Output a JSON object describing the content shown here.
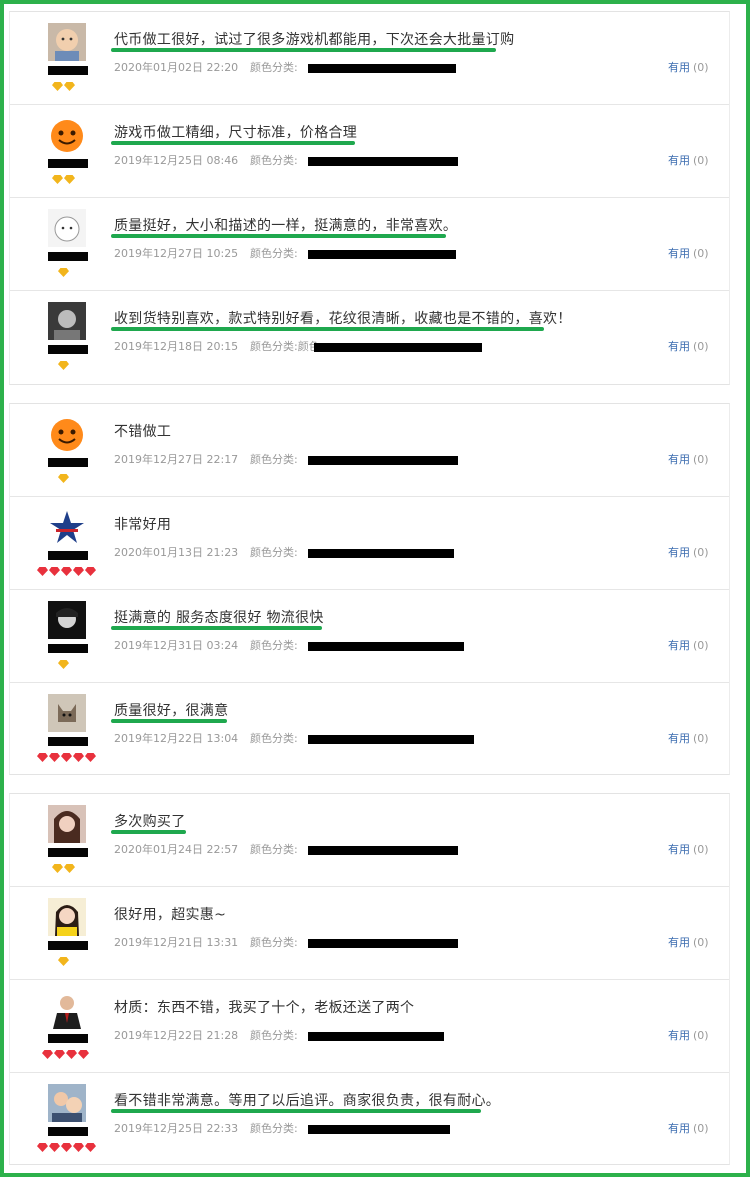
{
  "colors": {
    "frame": "#2db14b",
    "underline": "#1fa84e",
    "useful_link": "#3d6db0",
    "meta_text": "#999999"
  },
  "labels": {
    "sku": "颜色分类:",
    "useful": "有用",
    "count": "(0)"
  },
  "reviews": [
    {
      "text": "代币做工很好，试过了很多游戏机都能用，下次还会大批量订购",
      "date": "2020年01月02日 22:20",
      "sku_label": "颜色分类:",
      "avatar": "baby-photo",
      "badge": "gold",
      "badge_count": 2,
      "highlighted": true
    },
    {
      "text": "游戏币做工精细，尺寸标准，价格合理",
      "date": "2019年12月25日 08:46",
      "sku_label": "颜色分类:",
      "avatar": "orange-mascot",
      "badge": "gold",
      "badge_count": 2,
      "highlighted": true
    },
    {
      "text": "质量挺好，大小和描述的一样，挺满意的，非常喜欢。",
      "date": "2019年12月27日 10:25",
      "sku_label": "颜色分类:",
      "avatar": "white-cartoon",
      "badge": "gold",
      "badge_count": 1,
      "highlighted": true
    },
    {
      "text": "收到货特别喜欢，款式特别好看，花纹很清晰，收藏也是不错的，喜欢！",
      "date": "2019年12月18日 20:15",
      "sku_label": "颜色分类:颜色",
      "avatar": "dark-photo",
      "badge": "gold",
      "badge_count": 1,
      "highlighted": true
    },
    {
      "text": "不错做工",
      "date": "2019年12月27日 22:17",
      "sku_label": "颜色分类:",
      "avatar": "orange-mascot",
      "badge": "gold",
      "badge_count": 1,
      "highlighted": false
    },
    {
      "text": "非常好用",
      "date": "2020年01月13日 21:23",
      "sku_label": "颜色分类:",
      "avatar": "star-flag",
      "badge": "red",
      "badge_count": 5,
      "highlighted": false
    },
    {
      "text": "挺满意的 服务态度很好 物流很快",
      "date": "2019年12月31日 03:24",
      "sku_label": "颜色分类:",
      "avatar": "bw-portrait",
      "badge": "gold",
      "badge_count": 1,
      "highlighted": true
    },
    {
      "text": "质量很好，很满意",
      "date": "2019年12月22日 13:04",
      "sku_label": "颜色分类:",
      "avatar": "cat-sketch",
      "badge": "red",
      "badge_count": 5,
      "highlighted": true
    },
    {
      "text": "多次购买了",
      "date": "2020年01月24日 22:57",
      "sku_label": "颜色分类:",
      "avatar": "girl-photo",
      "badge": "gold",
      "badge_count": 2,
      "highlighted": true
    },
    {
      "text": "很好用，超实惠~",
      "date": "2019年12月21日 13:31",
      "sku_label": "颜色分类:",
      "avatar": "girl-yellow",
      "badge": "gold",
      "badge_count": 1,
      "highlighted": false
    },
    {
      "text": "材质：东西不错，我买了十个，老板还送了两个",
      "date": "2019年12月22日 21:28",
      "sku_label": "颜色分类:",
      "avatar": "man-suit",
      "badge": "red",
      "badge_count": 4,
      "highlighted": false
    },
    {
      "text": "看不错非常满意。等用了以后追评。商家很负责，很有耐心。",
      "date": "2019年12月25日 22:33",
      "sku_label": "颜色分类:",
      "avatar": "family-photo",
      "badge": "red",
      "badge_count": 5,
      "highlighted": true
    }
  ]
}
